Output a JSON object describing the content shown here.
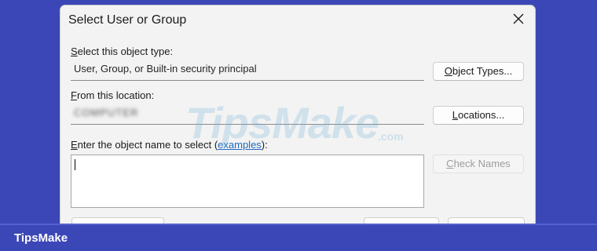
{
  "dialog": {
    "title": "Select User or Group",
    "object_type": {
      "label_first_letter": "S",
      "label_rest": "elect this object type:",
      "value": "User, Group, or Built-in security principal",
      "button_first_letter": "O",
      "button_rest": "bject Types..."
    },
    "location": {
      "label_first_letter": "F",
      "label_rest": "rom this location:",
      "value": "COMPUTER",
      "button_first_letter": "L",
      "button_rest": "ocations..."
    },
    "object_name": {
      "label_first_letter": "E",
      "label_rest": "nter the object name to select (",
      "link": "examples",
      "label_tail": "):",
      "value": "",
      "check_names_first_letter": "C",
      "check_names_rest": "heck Names"
    }
  },
  "watermark": {
    "main": "TipsMake",
    "suffix": ".com"
  },
  "footer": {
    "brand": "TipsMake"
  },
  "colors": {
    "background": "#3b47b6",
    "link": "#1f6ac0"
  },
  "icons": {
    "close": "close-icon"
  }
}
